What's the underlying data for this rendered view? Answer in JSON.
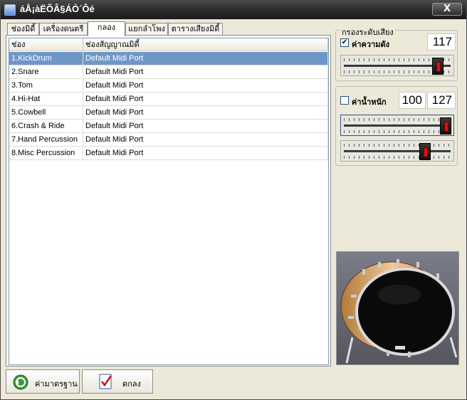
{
  "window": {
    "title": "áÅ¡àËÕÂ§ÁÒ´Ôé",
    "close_label": "X"
  },
  "tabs": [
    {
      "label": "ช่องมิดี้"
    },
    {
      "label": "เครื่องดนตรี"
    },
    {
      "label": "กลอง"
    },
    {
      "label": "แยกลำโพง"
    },
    {
      "label": "ตารางเสียงมิดี้"
    }
  ],
  "list": {
    "columns": [
      "ช่อง",
      "ช่องสัญญาณมิดี้"
    ],
    "rows": [
      {
        "name": "1.KickDrum",
        "port": "Default Midi Port"
      },
      {
        "name": "2.Snare",
        "port": "Default Midi Port"
      },
      {
        "name": "3.Tom",
        "port": "Default Midi Port"
      },
      {
        "name": "4.Hi-Hat",
        "port": "Default Midi Port"
      },
      {
        "name": "5.Cowbell",
        "port": "Default Midi Port"
      },
      {
        "name": "6.Crash & Ride",
        "port": "Default Midi Port"
      },
      {
        "name": "7.Hand Percussion",
        "port": "Default Midi Port"
      },
      {
        "name": "8.Misc Percussion",
        "port": "Default Midi Port"
      }
    ],
    "selected_index": 0
  },
  "filter_group": {
    "legend": "กรองระดับเสียง",
    "volume": {
      "label": "ค่าความดัง",
      "checked": true,
      "value": "117",
      "level": 0.92
    },
    "weight": {
      "label": "ค่าน้ำหนัก",
      "checked": false,
      "value_low": "100",
      "value_high": "127",
      "level_top": 1.0,
      "level_bottom": 0.79
    }
  },
  "buttons": {
    "default_label": "ค่ามาตรฐาน",
    "ok_label": "ตกลง"
  }
}
